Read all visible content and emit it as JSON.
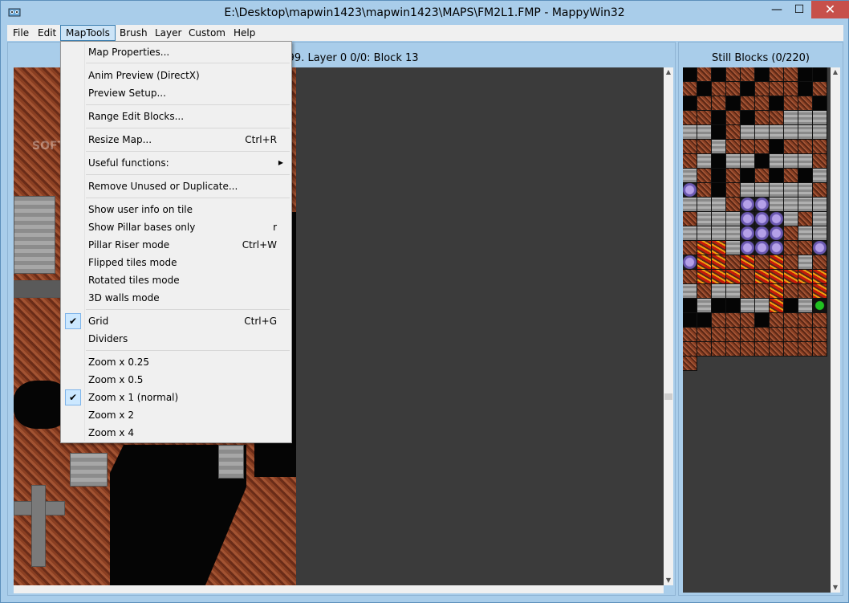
{
  "window": {
    "title": "E:\\Desktop\\mapwin1423\\mapwin1423\\MAPS\\FM2L1.FMP - MappyWin32",
    "minimize_glyph": "—",
    "maximize_glyph": "☐",
    "close_glyph": "✕"
  },
  "menubar": {
    "items": [
      {
        "label": "File"
      },
      {
        "label": "Edit"
      },
      {
        "label": "MapTools"
      },
      {
        "label": "Brush"
      },
      {
        "label": "Layer"
      },
      {
        "label": "Custom"
      },
      {
        "label": "Help"
      }
    ],
    "active": "MapTools"
  },
  "map_window": {
    "title": "28/199. Layer 0 0/0: Block 13"
  },
  "block_window": {
    "title": "Still Blocks (0/220)"
  },
  "watermark": "SOFTPEDIA",
  "maptools_menu": {
    "items": [
      {
        "label": "Map Properties...",
        "shortcut": ""
      },
      {
        "label": "Anim Preview (DirectX)",
        "shortcut": ""
      },
      {
        "label": "Preview Setup...",
        "shortcut": ""
      },
      {
        "label": "Range Edit Blocks...",
        "shortcut": ""
      },
      {
        "label": "Resize Map...",
        "shortcut": "Ctrl+R"
      },
      {
        "label": "Useful functions:",
        "shortcut": ""
      },
      {
        "label": "Remove Unused or Duplicate...",
        "shortcut": ""
      },
      {
        "label": "Show user info on tile",
        "shortcut": ""
      },
      {
        "label": "Show Pillar bases only",
        "shortcut": "r"
      },
      {
        "label": "Pillar Riser mode",
        "shortcut": "Ctrl+W"
      },
      {
        "label": "Flipped tiles mode",
        "shortcut": ""
      },
      {
        "label": "Rotated tiles mode",
        "shortcut": ""
      },
      {
        "label": "3D walls mode",
        "shortcut": ""
      },
      {
        "label": "Grid",
        "shortcut": "Ctrl+G",
        "checked": true
      },
      {
        "label": "Dividers",
        "shortcut": ""
      },
      {
        "label": "Zoom x 0.25",
        "shortcut": ""
      },
      {
        "label": "Zoom x 0.5",
        "shortcut": ""
      },
      {
        "label": "Zoom x 1 (normal)",
        "shortcut": "",
        "checked": true
      },
      {
        "label": "Zoom x 2",
        "shortcut": ""
      },
      {
        "label": "Zoom x 4",
        "shortcut": ""
      }
    ],
    "submenu_arrow": "▶",
    "check_glyph": "✔"
  },
  "colors": {
    "frame": "#a9cdea",
    "menu_highlight": "#cce4f7",
    "close_button": "#c7504a",
    "editor_background": "#3b3b3b"
  }
}
